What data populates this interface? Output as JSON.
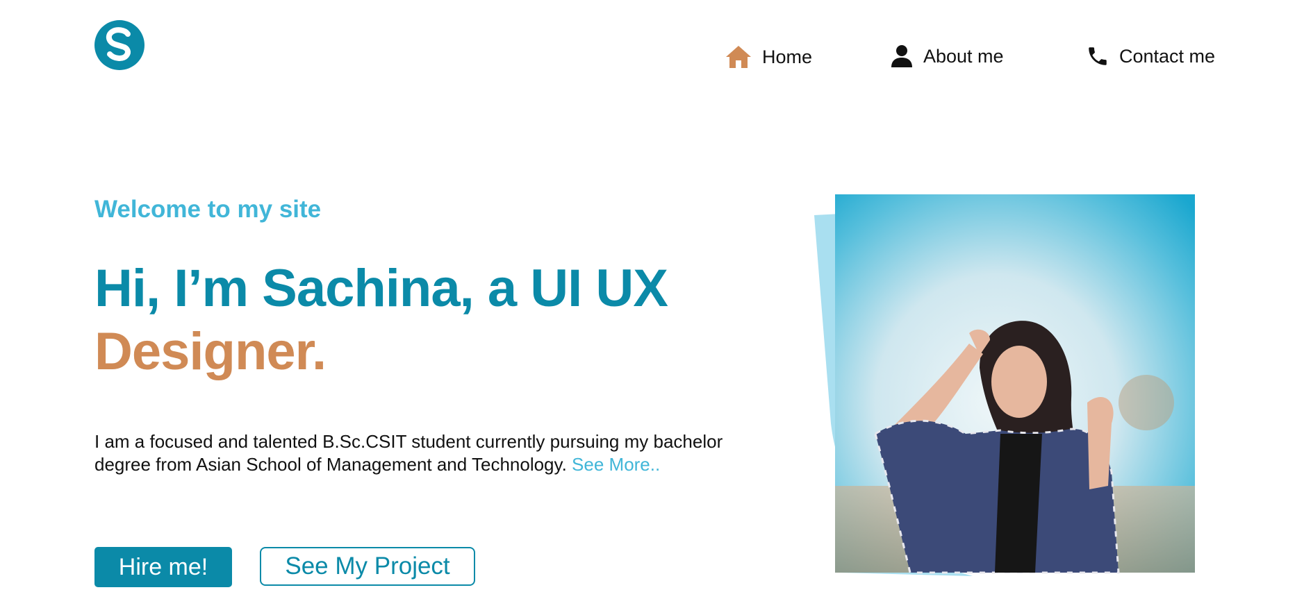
{
  "header": {
    "logo_letter": "S",
    "nav": [
      {
        "label": "Home",
        "icon": "home-icon",
        "active": true
      },
      {
        "label": "About me",
        "icon": "person-icon"
      },
      {
        "label": "Contact me",
        "icon": "phone-icon"
      }
    ]
  },
  "hero": {
    "welcome": "Welcome to my site",
    "headline_line1": "Hi, I’m Sachina, a UI UX",
    "headline_line2": "Designer.",
    "bio_text": "I am a focused and talented B.Sc.CSIT student currently pursuing my bachelor degree from Asian School of Management and Technology.",
    "bio_link": "See More..",
    "hire_button": "Hire me!",
    "project_button": "See My Project"
  },
  "colors": {
    "primary": "#0b8aa8",
    "accent": "#d08a55",
    "light_blue": "#41b6d8",
    "frame_blue": "#a9dff0"
  }
}
